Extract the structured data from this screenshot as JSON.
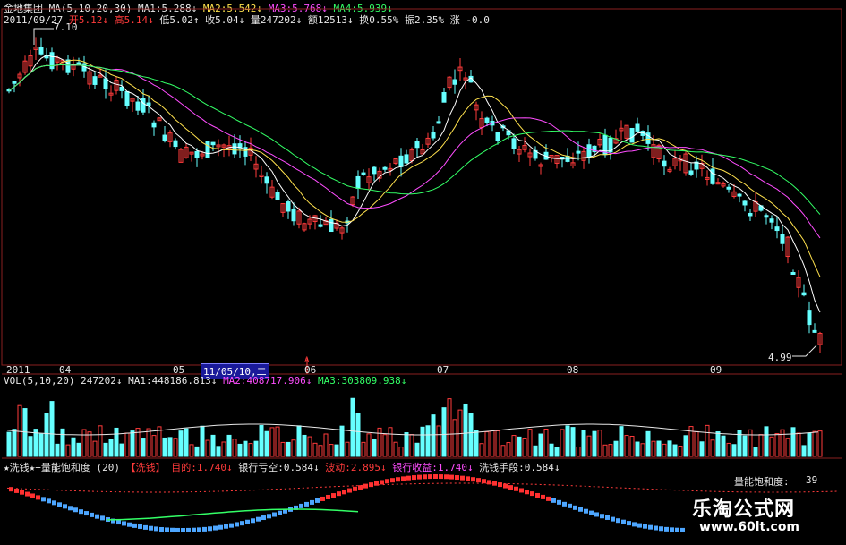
{
  "main_panel": {
    "stock_name": "金地集团",
    "ma_label": "MA(5,10,20,30)",
    "ma1": "MA1:5.288↓",
    "ma2": "MA2:5.542↓",
    "ma3": "MA3:5.768↓",
    "ma4": "MA4:5.939↓",
    "date_line_date": "2011/09/27",
    "open": "开5.12↓",
    "high": "高5.14↓",
    "low": "低5.02↑",
    "close": "收5.04↓",
    "volume": "量247202↓",
    "amount": "额12513↓",
    "turnover": "换0.55%",
    "amplitude": "振2.35%",
    "change": "涨 -0.0",
    "high_marker": "7.10",
    "low_marker": "4.99"
  },
  "time_axis": {
    "labels": [
      "2011",
      "04",
      "05",
      "06",
      "07",
      "08",
      "09"
    ],
    "cursor_date": "11/05/10,二",
    "cursor_mark": "A"
  },
  "vol_panel": {
    "label": "VOL(5,10,20)",
    "value": "247202↓",
    "ma1": "MA1:448186.813↓",
    "ma2": "MA2:408717.906↓",
    "ma3": "MA3:303809.938↓"
  },
  "indicator_panel": {
    "name": "★洗钱★+量能饱和度",
    "param": "(20)",
    "tag": "【洗钱】",
    "target": "目的:1.740↓",
    "bank_deficit": "银行亏空:0.584↓",
    "volatility": "波动:2.895↓",
    "bank_income": "银行收益:1.740↓",
    "means": "洗钱手段:0.584↓",
    "saturation_label": "量能饱和度:",
    "saturation_value": "39"
  },
  "watermark": {
    "title": "乐淘公式网",
    "url": "www.60lt.com"
  },
  "colors": {
    "background": "#000000",
    "up_candle": "#ff3b3b",
    "down_candle": "#66ffff",
    "ma1": "#ffffff",
    "ma2": "#ffe14d",
    "ma3": "#ff4dff",
    "ma4": "#33ff66",
    "border": "#8a1f1f"
  }
}
